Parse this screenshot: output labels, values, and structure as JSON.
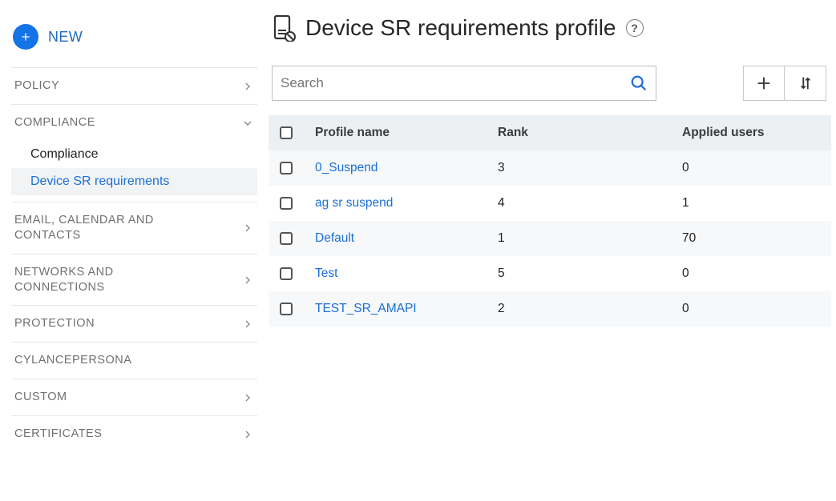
{
  "sidebar": {
    "new_label": "NEW",
    "items": [
      {
        "label": "POLICY",
        "expanded": false
      },
      {
        "label": "COMPLIANCE",
        "expanded": true,
        "subitems": [
          {
            "label": "Compliance",
            "active": false
          },
          {
            "label": "Device SR requirements",
            "active": true
          }
        ]
      },
      {
        "label": "EMAIL, CALENDAR AND CONTACTS",
        "expanded": false
      },
      {
        "label": "NETWORKS AND CONNECTIONS",
        "expanded": false
      },
      {
        "label": "PROTECTION",
        "expanded": false
      },
      {
        "label": "CYLANCEPERSONA",
        "expanded": null
      },
      {
        "label": "CUSTOM",
        "expanded": false
      },
      {
        "label": "CERTIFICATES",
        "expanded": false
      }
    ]
  },
  "page": {
    "title": "Device SR requirements profile",
    "search_placeholder": "Search",
    "columns": {
      "name": "Profile name",
      "rank": "Rank",
      "users": "Applied users"
    },
    "rows": [
      {
        "name": "0_Suspend",
        "rank": "3",
        "users": "0"
      },
      {
        "name": "ag sr suspend",
        "rank": "4",
        "users": "1"
      },
      {
        "name": "Default",
        "rank": "1",
        "users": "70"
      },
      {
        "name": "Test",
        "rank": "5",
        "users": "0"
      },
      {
        "name": "TEST_SR_AMAPI",
        "rank": "2",
        "users": "0"
      }
    ]
  }
}
